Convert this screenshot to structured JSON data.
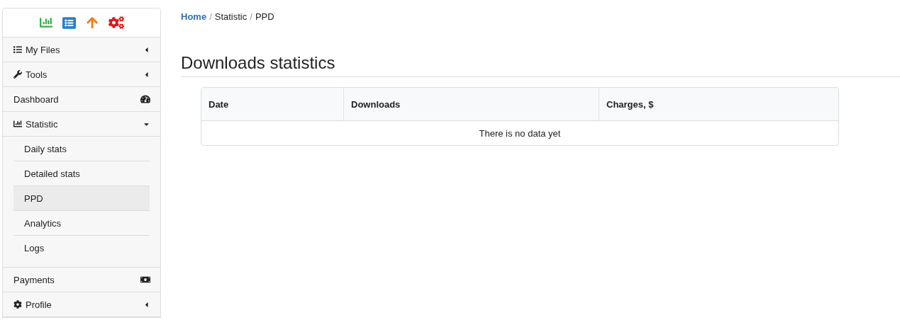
{
  "sidebar": {
    "items": [
      {
        "label": "My Files",
        "expanded": false
      },
      {
        "label": "Tools",
        "expanded": false
      },
      {
        "label": "Dashboard"
      },
      {
        "label": "Statistic",
        "expanded": true,
        "children": [
          {
            "label": "Daily stats",
            "selected": false
          },
          {
            "label": "Detailed stats",
            "selected": false
          },
          {
            "label": "PPD",
            "selected": true
          },
          {
            "label": "Analytics",
            "selected": false
          },
          {
            "label": "Logs",
            "selected": false
          }
        ]
      },
      {
        "label": "Payments"
      },
      {
        "label": "Profile",
        "expanded": false
      }
    ]
  },
  "breadcrumb_separator": "/",
  "breadcrumb": [
    {
      "label": "Home",
      "kind": "link"
    },
    {
      "label": "Statistic",
      "kind": "text"
    },
    {
      "label": "PPD",
      "kind": "text"
    }
  ],
  "title": "Downloads statistics",
  "table": {
    "columns": [
      "Date",
      "Downloads",
      "Charges, $"
    ],
    "empty_message": "There is no data yet"
  }
}
